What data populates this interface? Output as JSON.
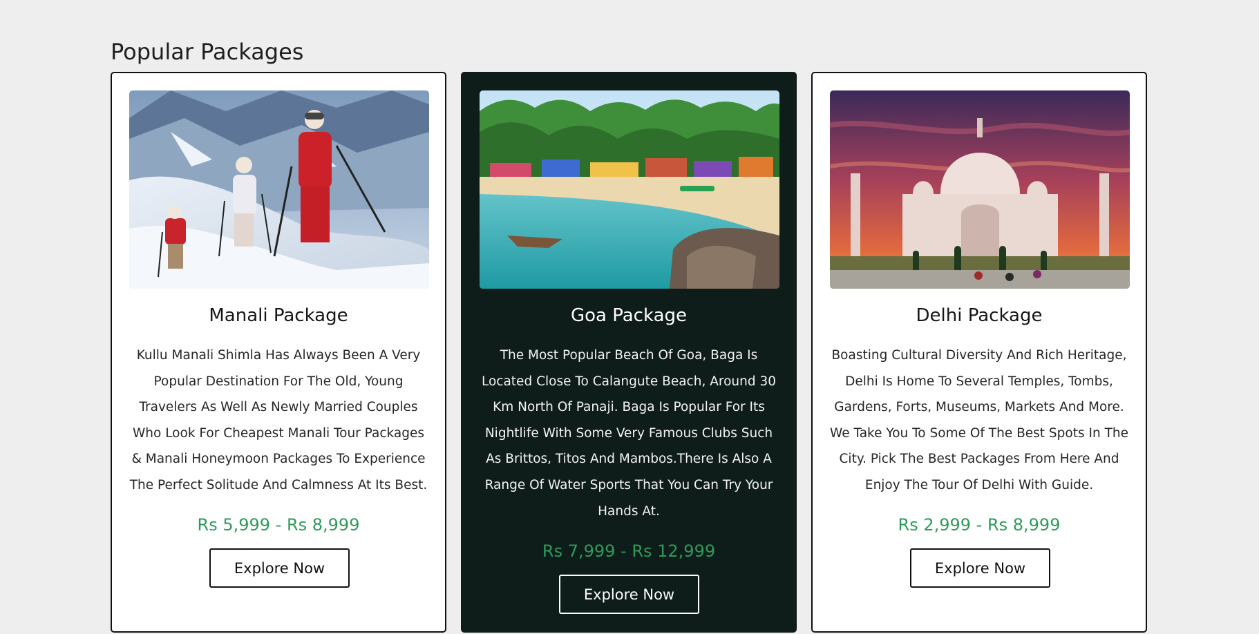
{
  "section": {
    "title": "Popular Packages"
  },
  "colors": {
    "page_background": "#eeeeee",
    "dark_card": "#0f1d1a",
    "price": "#2e9a5a"
  },
  "packages": [
    {
      "title": "Manali Package",
      "description": "Kullu Manali Shimla Has Always Been A Very Popular Destination For The Old, Young Travelers As Well As Newly Married Couples Who Look For Cheapest Manali Tour Packages & Manali Honeymoon Packages To Experience The Perfect Solitude And Calmness At Its Best.",
      "price": "Rs 5,999 - Rs 8,999",
      "button_label": "Explore Now",
      "image": "snowy-mountain-hikers-photo",
      "theme": "light"
    },
    {
      "title": "Goa Package",
      "description": "The Most Popular Beach Of Goa, Baga Is Located Close To Calangute Beach, Around 30 Km North Of Panaji. Baga Is Popular For Its Nightlife With Some Very Famous Clubs Such As Brittos, Titos And Mambos.There Is Also A Range Of Water Sports That You Can Try Your Hands At.",
      "price": "Rs 7,999 - Rs 12,999",
      "button_label": "Explore Now",
      "image": "tropical-beach-photo",
      "theme": "dark"
    },
    {
      "title": "Delhi Package",
      "description": "Boasting Cultural Diversity And Rich Heritage, Delhi Is Home To Several Temples, Tombs, Gardens, Forts, Museums, Markets And More. We Take You To Some Of The Best Spots In The City. Pick The Best Packages From Here And Enjoy The Tour Of Delhi With Guide.",
      "price": "Rs 2,999 - Rs 8,999",
      "button_label": "Explore Now",
      "image": "taj-mahal-sunset-photo",
      "theme": "light"
    }
  ]
}
